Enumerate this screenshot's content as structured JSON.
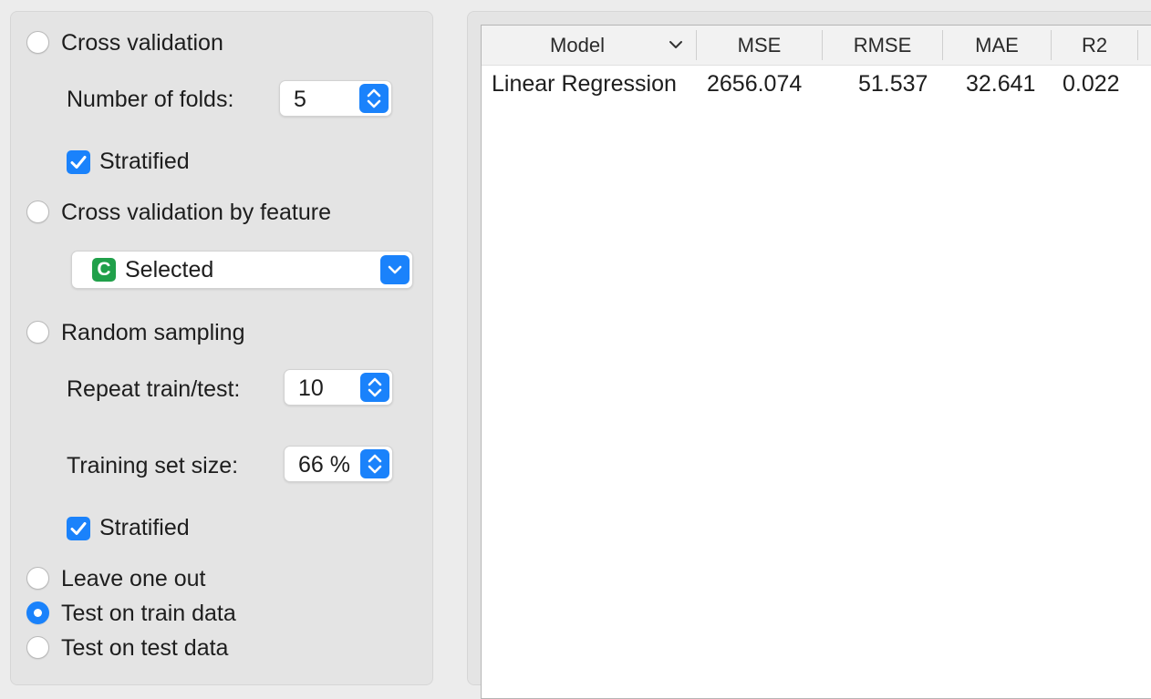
{
  "sampling": {
    "cross_validation": {
      "label": "Cross validation",
      "selected": false
    },
    "number_of_folds": {
      "label": "Number of folds:",
      "value": "5"
    },
    "stratified_cv": {
      "label": "Stratified",
      "checked": true
    },
    "cross_validation_by_feature": {
      "label": "Cross validation by feature",
      "selected": false
    },
    "feature_select": {
      "badge": "C",
      "value": "Selected"
    },
    "random_sampling": {
      "label": "Random sampling",
      "selected": false
    },
    "repeat_train_test": {
      "label": "Repeat train/test:",
      "value": "10"
    },
    "training_set_size": {
      "label": "Training set size:",
      "value": "66 %"
    },
    "stratified_rs": {
      "label": "Stratified",
      "checked": true
    },
    "leave_one_out": {
      "label": "Leave one out",
      "selected": false
    },
    "test_on_train_data": {
      "label": "Test on train data",
      "selected": true
    },
    "test_on_test_data": {
      "label": "Test on test data",
      "selected": false
    }
  },
  "results_table": {
    "columns": [
      "Model",
      "MSE",
      "RMSE",
      "MAE",
      "R2"
    ],
    "rows": [
      [
        "Linear Regression",
        "2656.074",
        "51.537",
        "32.641",
        "0.022"
      ]
    ]
  },
  "colors": {
    "accent": "#1a82fb",
    "badge_green": "#20a04a"
  }
}
